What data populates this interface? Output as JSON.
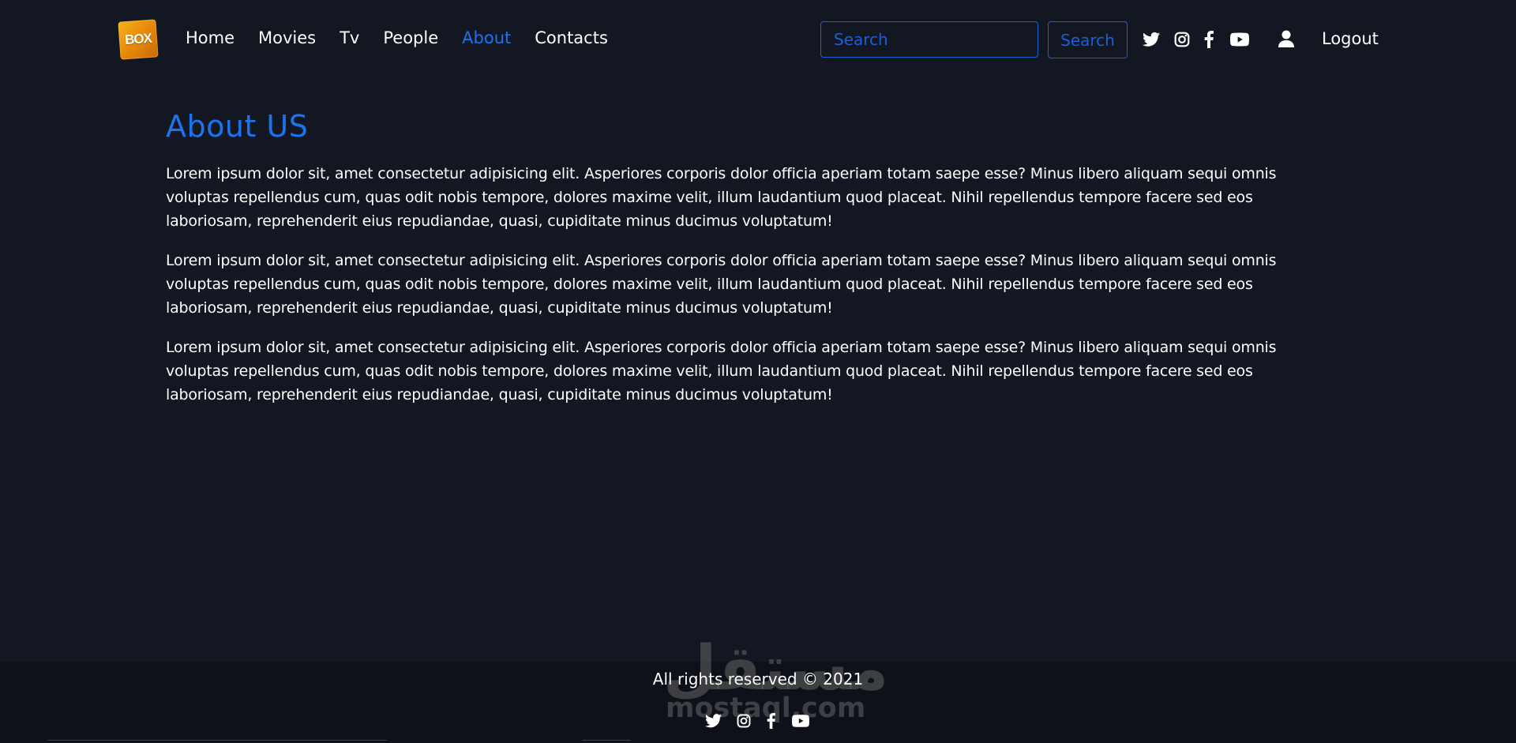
{
  "header": {
    "logo_text": "BOX",
    "nav": [
      {
        "label": "Home",
        "active": false
      },
      {
        "label": "Movies",
        "active": false
      },
      {
        "label": "Tv",
        "active": false
      },
      {
        "label": "People",
        "active": false
      },
      {
        "label": "About",
        "active": true
      },
      {
        "label": "Contacts",
        "active": false
      }
    ],
    "search": {
      "value": "",
      "placeholder": "Search",
      "button_label": "Search"
    },
    "social_icons": [
      "twitter-icon",
      "instagram-icon",
      "facebook-icon",
      "youtube-icon"
    ],
    "user_icon": "user-icon",
    "logout_label": "Logout"
  },
  "main": {
    "title": "About US",
    "paragraphs": [
      "Lorem ipsum dolor sit, amet consectetur adipisicing elit. Asperiores corporis dolor officia aperiam totam saepe esse? Minus libero aliquam sequi omnis voluptas repellendus cum, quas odit nobis tempore, dolores maxime velit, illum laudantium quod placeat. Nihil repellendus tempore facere sed eos laboriosam, reprehenderit eius repudiandae, quasi, cupiditate minus ducimus voluptatum!",
      "Lorem ipsum dolor sit, amet consectetur adipisicing elit. Asperiores corporis dolor officia aperiam totam saepe esse? Minus libero aliquam sequi omnis voluptas repellendus cum, quas odit nobis tempore, dolores maxime velit, illum laudantium quod placeat. Nihil repellendus tempore facere sed eos laboriosam, reprehenderit eius repudiandae, quasi, cupiditate minus ducimus voluptatum!",
      "Lorem ipsum dolor sit, amet consectetur adipisicing elit. Asperiores corporis dolor officia aperiam totam saepe esse? Minus libero aliquam sequi omnis voluptas repellendus cum, quas odit nobis tempore, dolores maxime velit, illum laudantium quod placeat. Nihil repellendus tempore facere sed eos laboriosam, reprehenderit eius repudiandae, quasi, cupiditate minus ducimus voluptatum!"
    ]
  },
  "footer": {
    "copyright": "All rights reserved © 2021",
    "social_icons": [
      "twitter-icon",
      "instagram-icon",
      "facebook-icon",
      "youtube-icon"
    ]
  },
  "watermark": {
    "arabic": "مستقل",
    "latin": "mostaql.com"
  },
  "colors": {
    "background": "#131722",
    "footer_background": "#0e1119",
    "accent": "#1a73f0",
    "text": "#ffffff"
  }
}
